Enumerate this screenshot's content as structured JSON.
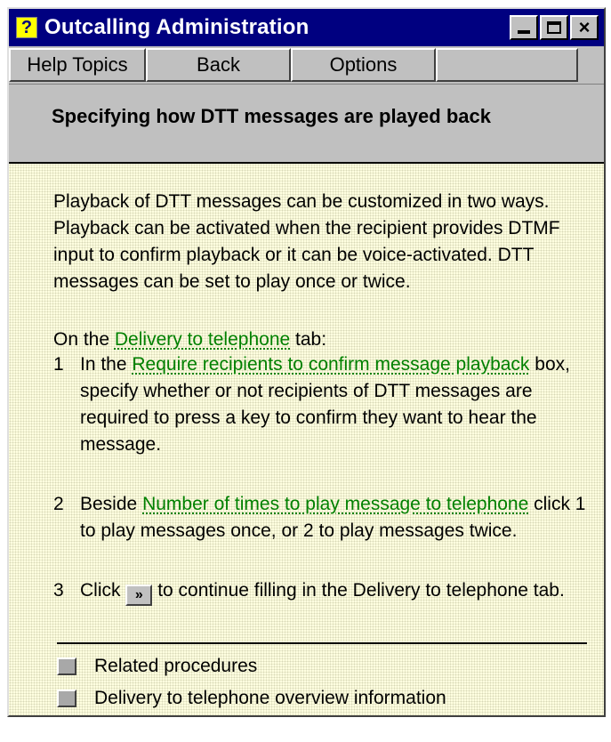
{
  "window": {
    "title": "Outcalling Administration",
    "title_icon": "?",
    "controls": {
      "minimize": "minimize-icon",
      "maximize": "maximize-icon",
      "close": "×"
    }
  },
  "toolbar": {
    "help_topics": "Help Topics",
    "back": "Back",
    "options": "Options"
  },
  "header": {
    "title": "Specifying how DTT messages are played back"
  },
  "content": {
    "intro": "Playback of DTT messages can be customized in two ways. Playback can be activated when the recipient provides DTMF input to confirm playback or it can be voice-activated. DTT messages can be set to play once or twice.",
    "on_the_prefix": "On the",
    "on_the_link": "Delivery to telephone",
    "on_the_suffix": "tab:",
    "steps": [
      {
        "num": "1",
        "prefix": "In the",
        "link": "Require recipients to confirm message playback",
        "suffix": "box, specify whether or not recipients of DTT messages are required to press a key to confirm they want to hear the message."
      },
      {
        "num": "2",
        "prefix": "Beside",
        "link": "Number of times to play message to telephone",
        "suffix": "click 1 to play messages once, or 2 to play messages twice."
      },
      {
        "num": "3",
        "prefix": "Click",
        "button": "»",
        "suffix": "to continue filling in the Delivery to telephone tab."
      }
    ],
    "related": [
      {
        "label": "Related procedures"
      },
      {
        "label": "Delivery to telephone overview information"
      }
    ]
  },
  "colors": {
    "titlebar": "#000080",
    "link": "#008000",
    "content_bg": "#ffffe0",
    "chrome": "#c0c0c0"
  }
}
